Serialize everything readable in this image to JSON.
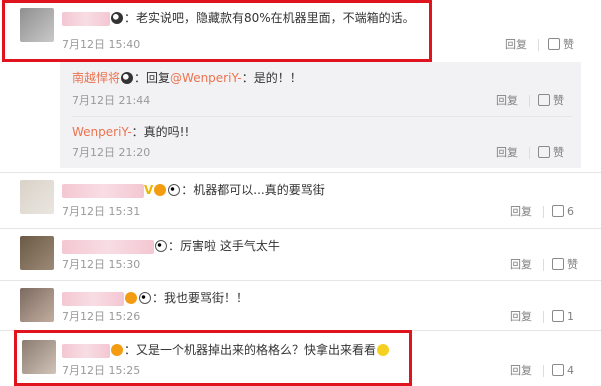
{
  "comments": [
    {
      "text": "：老实说吧，隐藏款有80%在机器里面，不端箱的话。",
      "time": "7月12日 15:40",
      "reply_label": "回复",
      "like_label": "赞",
      "like_count": ""
    },
    {
      "author": "南越悍将",
      "text_prefix": "：回复",
      "mention": "@WenperiY-",
      "text_suffix": "：是的！！",
      "time": "7月12日 21:44",
      "reply_label": "回复",
      "like_label": "赞"
    },
    {
      "author": "WenperiY-",
      "text": "：真的吗!!",
      "time": "7月12日 21:20",
      "reply_label": "回复",
      "like_label": "赞"
    },
    {
      "text": "：机器都可以...真的要骂街",
      "time": "7月12日 15:31",
      "reply_label": "回复",
      "like_count": "6"
    },
    {
      "text": "：厉害啦 这手气太牛",
      "time": "7月12日 15:30",
      "reply_label": "回复",
      "like_label": "赞"
    },
    {
      "text": "：我也要骂街！！",
      "time": "7月12日 15:26",
      "reply_label": "回复",
      "like_count": "1"
    },
    {
      "text": "：又是一个机器掉出来的格格么？快拿出来看看",
      "time": "7月12日 15:25",
      "reply_label": "回复",
      "like_count": "4"
    }
  ],
  "colors": {
    "highlight_border": "#e0141e",
    "author_link": "#eb7350"
  }
}
